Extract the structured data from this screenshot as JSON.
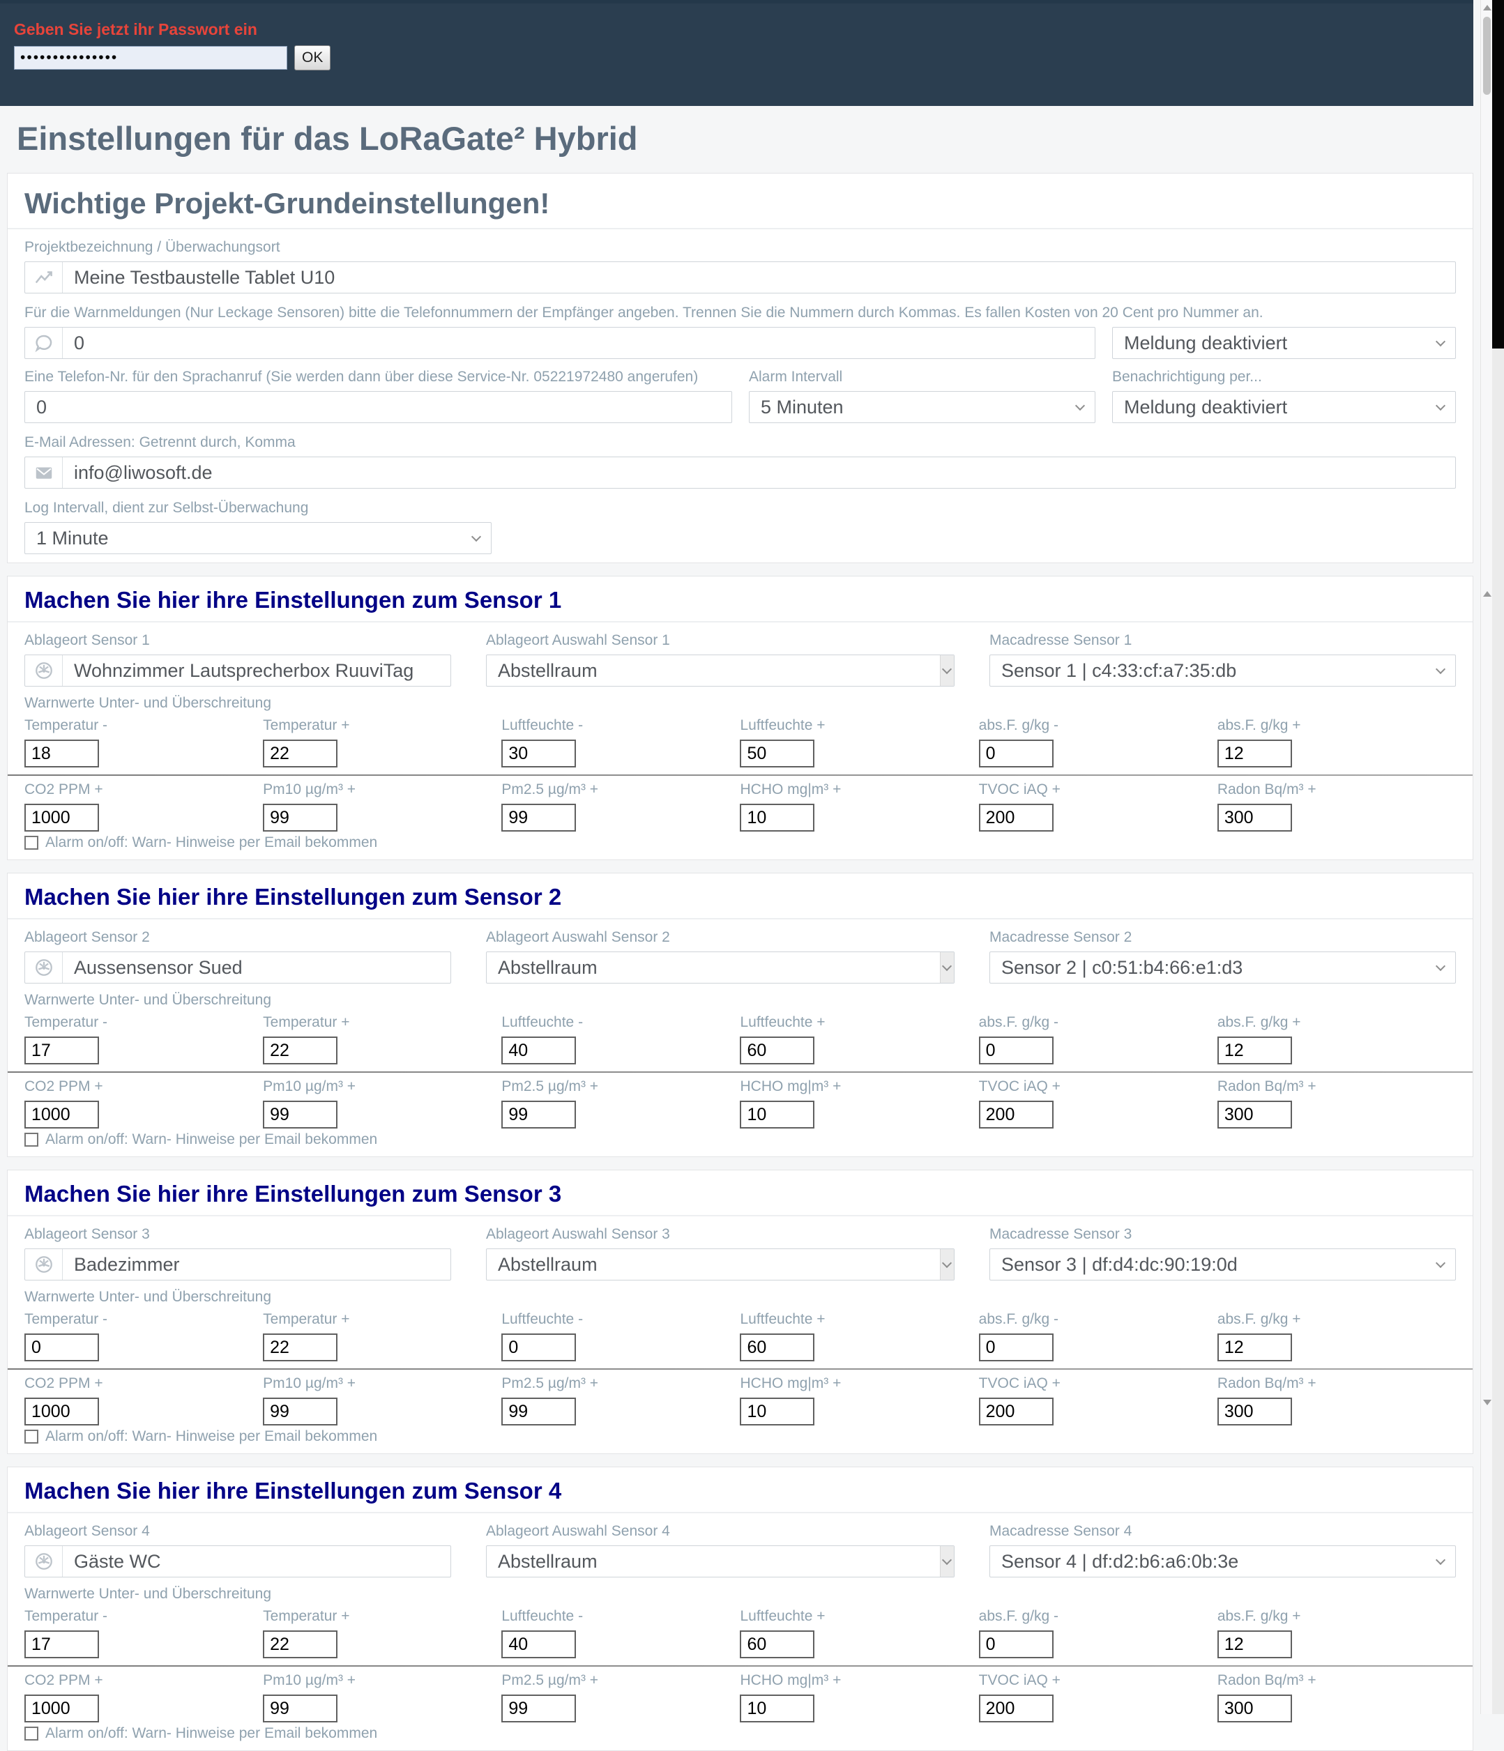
{
  "colors": {
    "header_bg": "#2b3e50",
    "alert_red": "#e8443a",
    "heading_gray_blue": "#5a6b7c",
    "sensor_heading_navy": "#020286",
    "label_gray": "#8fa1ae"
  },
  "password_bar": {
    "prompt": "Geben Sie jetzt ihr Passwort ein",
    "password_masked": "•••••••••••••••",
    "ok_label": "OK"
  },
  "page": {
    "title": "Einstellungen für das LoRaGate² Hybrid"
  },
  "general": {
    "heading": "Wichtige Projekt-Grundeinstellungen!",
    "project_label": "Projektbezeichnung / Überwachungsort",
    "project_value": "Meine Testbaustelle Tablet U10",
    "warn_phone_label": "Für die Warnmeldungen (Nur Leckage Sensoren) bitte die Telefonnummern der Empfänger angeben. Trennen Sie die Nummern durch Kommas. Es fallen Kosten von 20 Cent pro Nummer an.",
    "phone_numbers_value": "0",
    "phone_notify_value": "Meldung deaktiviert",
    "voice_label": "Eine Telefon-Nr. für den Sprachanruf (Sie werden dann über diese Service-Nr. 05221972480 angerufen)",
    "voice_value": "0",
    "alarm_interval_label": "Alarm Intervall",
    "alarm_interval_value": "5 Minuten",
    "notify_label": "Benachrichtigung per...",
    "notify_value": "Meldung deaktiviert",
    "email_label": "E-Mail Adressen: Getrennt durch, Komma",
    "email_value": "info@liwosoft.de",
    "log_label": "Log Intervall, dient zur Selbst-Überwachung",
    "log_value": "1 Minute"
  },
  "sensor_common": {
    "warnwerte_label": "Warnwerte Unter- und Überschreitung",
    "checkbox_label": "Alarm on/off: Warn- Hinweise per Email bekommen",
    "row1_labels": [
      "Temperatur -",
      "Temperatur +",
      "Luftfeuchte -",
      "Luftfeuchte +",
      "abs.F. g/kg -",
      "abs.F. g/kg +"
    ],
    "row2_labels": [
      "CO2 PPM +",
      "Pm10 µg/m³ +",
      "Pm2.5 µg/m³ +",
      "HCHO mg|m³ +",
      "TVOC iAQ +",
      "Radon Bq/m³ +"
    ]
  },
  "sensors": [
    {
      "heading": "Machen Sie hier ihre Einstellungen zum Sensor 1",
      "ablageort_label": "Ablageort Sensor 1",
      "auswahl_label": "Ablageort Auswahl Sensor 1",
      "mac_label": "Macadresse Sensor 1",
      "name": "Wohnzimmer Lautsprecherbox RuuviTag",
      "room": "Abstellraum",
      "mac": "Sensor 1 | c4:33:cf:a7:35:db",
      "row1_values": [
        "18",
        "22",
        "30",
        "50",
        "0",
        "12"
      ],
      "row2_values": [
        "1000",
        "99",
        "99",
        "10",
        "200",
        "300"
      ]
    },
    {
      "heading": "Machen Sie hier ihre Einstellungen zum Sensor 2",
      "ablageort_label": "Ablageort Sensor 2",
      "auswahl_label": "Ablageort Auswahl Sensor 2",
      "mac_label": "Macadresse Sensor 2",
      "name": "Aussensensor Sued",
      "room": "Abstellraum",
      "mac": "Sensor 2 | c0:51:b4:66:e1:d3",
      "row1_values": [
        "17",
        "22",
        "40",
        "60",
        "0",
        "12"
      ],
      "row2_values": [
        "1000",
        "99",
        "99",
        "10",
        "200",
        "300"
      ]
    },
    {
      "heading": "Machen Sie hier ihre Einstellungen zum Sensor 3",
      "ablageort_label": "Ablageort Sensor 3",
      "auswahl_label": "Ablageort Auswahl Sensor 3",
      "mac_label": "Macadresse Sensor 3",
      "name": "Badezimmer",
      "room": "Abstellraum",
      "mac": "Sensor 3 | df:d4:dc:90:19:0d",
      "row1_values": [
        "0",
        "22",
        "0",
        "60",
        "0",
        "12"
      ],
      "row2_values": [
        "1000",
        "99",
        "99",
        "10",
        "200",
        "300"
      ]
    },
    {
      "heading": "Machen Sie hier ihre Einstellungen zum Sensor 4",
      "ablageort_label": "Ablageort Sensor 4",
      "auswahl_label": "Ablageort Auswahl Sensor 4",
      "mac_label": "Macadresse Sensor 4",
      "name": "Gäste WC",
      "room": "Abstellraum",
      "mac": "Sensor 4 | df:d2:b6:a6:0b:3e",
      "row1_values": [
        "17",
        "22",
        "40",
        "60",
        "0",
        "12"
      ],
      "row2_values": [
        "1000",
        "99",
        "99",
        "10",
        "200",
        "300"
      ]
    }
  ]
}
